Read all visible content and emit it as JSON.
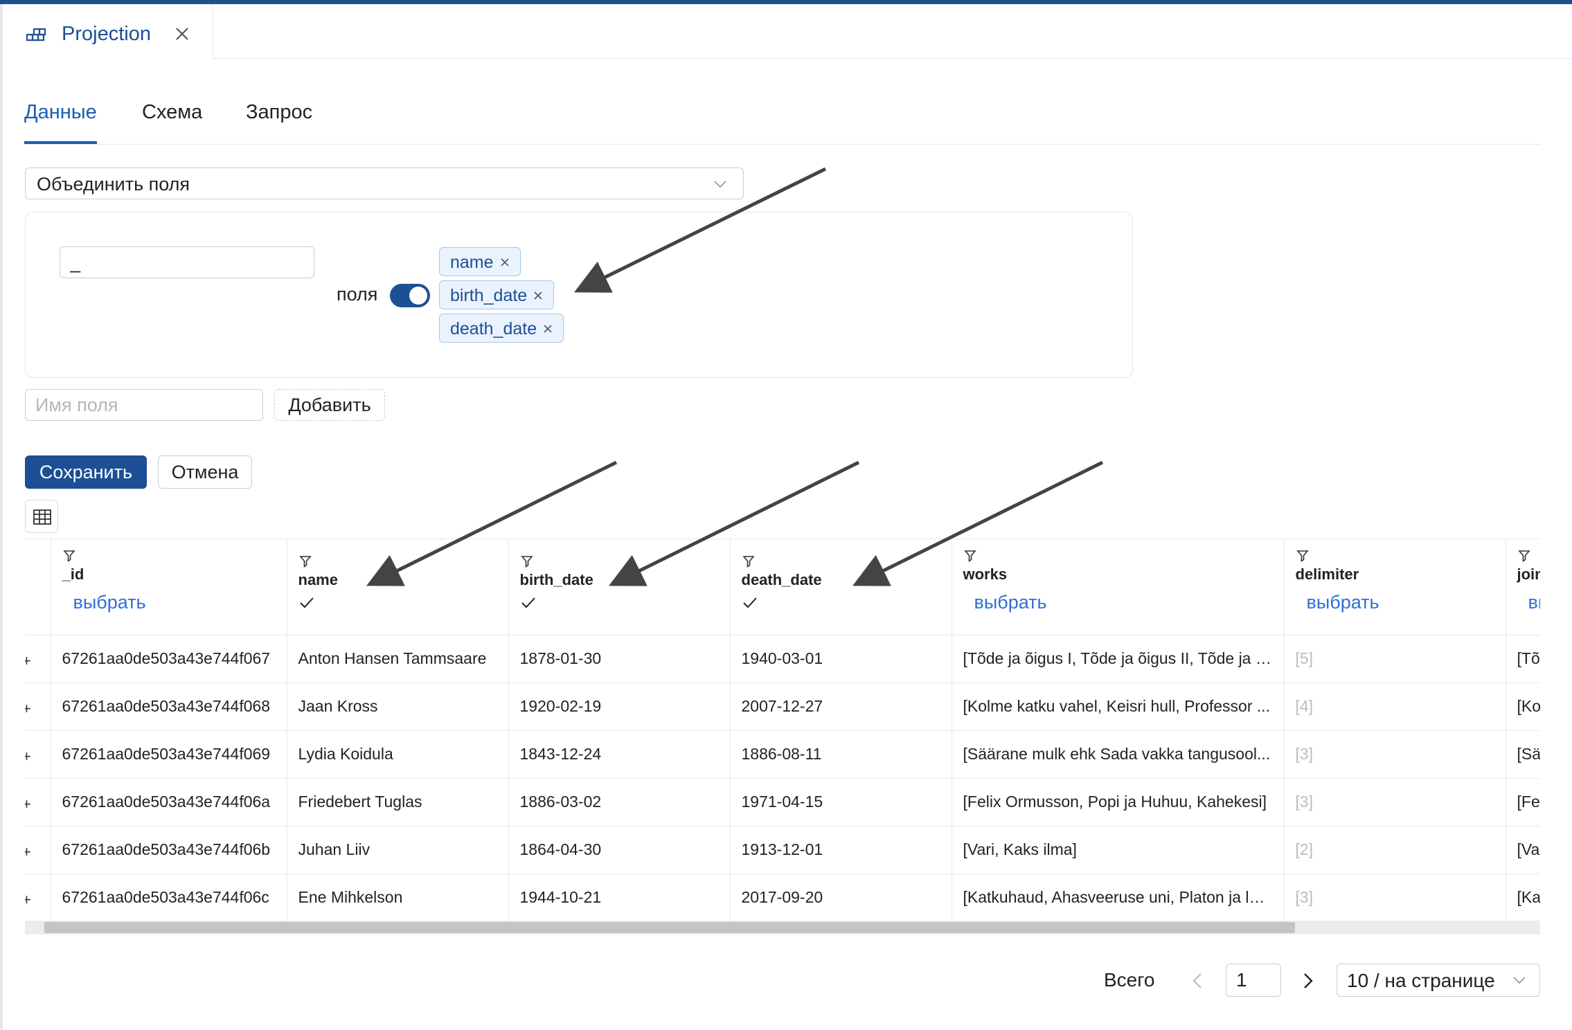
{
  "window_tab": {
    "title": "Projection",
    "icon": "projection-icon",
    "close_icon": "close-icon"
  },
  "tabs": [
    {
      "label": "Данные",
      "active": true
    },
    {
      "label": "Схема",
      "active": false
    },
    {
      "label": "Запрос",
      "active": false
    }
  ],
  "operation_select": {
    "value": "Объединить поля",
    "icon": "chevron-down-icon"
  },
  "merge_config": {
    "separator_value": "_",
    "fields_label": "поля",
    "toggle_on": true,
    "selected_fields": [
      "name",
      "birth_date",
      "death_date"
    ]
  },
  "add_field": {
    "placeholder": "Имя поля",
    "button_label": "Добавить"
  },
  "actions": {
    "save_label": "Сохранить",
    "cancel_label": "Отмена"
  },
  "table": {
    "columns": [
      {
        "key": "_id",
        "title": "_id",
        "state": "pick",
        "pick_label": "выбрать"
      },
      {
        "key": "name",
        "title": "name",
        "state": "check"
      },
      {
        "key": "birth_date",
        "title": "birth_date",
        "state": "check"
      },
      {
        "key": "death_date",
        "title": "death_date",
        "state": "check"
      },
      {
        "key": "works",
        "title": "works",
        "state": "pick",
        "pick_label": "выбрать"
      },
      {
        "key": "delimiter",
        "title": "delimiter",
        "state": "pick",
        "pick_label": "выбрать"
      },
      {
        "key": "join",
        "title": "join",
        "state": "pick",
        "pick_label": "выбрать"
      }
    ],
    "rows": [
      {
        "_id": "67261aa0de503a43e744f067",
        "name": "Anton Hansen Tammsaare",
        "birth_date": "1878-01-30",
        "death_date": "1940-03-01",
        "works": "[Tõde ja õigus I, Tõde ja õigus II, Tõde ja õ...",
        "delimiter": "[5]",
        "join": "[Tõ"
      },
      {
        "_id": "67261aa0de503a43e744f068",
        "name": "Jaan Kross",
        "birth_date": "1920-02-19",
        "death_date": "2007-12-27",
        "works": "[Kolme katku vahel, Keisri hull, Professor ...",
        "delimiter": "[4]",
        "join": "[Ko"
      },
      {
        "_id": "67261aa0de503a43e744f069",
        "name": "Lydia Koidula",
        "birth_date": "1843-12-24",
        "death_date": "1886-08-11",
        "works": "[Säärane mulk ehk Sada vakka tangusool...",
        "delimiter": "[3]",
        "join": "[Sä"
      },
      {
        "_id": "67261aa0de503a43e744f06a",
        "name": "Friedebert Tuglas",
        "birth_date": "1886-03-02",
        "death_date": "1971-04-15",
        "works": "[Felix Ormusson, Popi ja Huhuu, Kahekesi]",
        "delimiter": "[3]",
        "join": "[Fe"
      },
      {
        "_id": "67261aa0de503a43e744f06b",
        "name": "Juhan Liiv",
        "birth_date": "1864-04-30",
        "death_date": "1913-12-01",
        "works": "[Vari, Kaks ilma]",
        "delimiter": "[2]",
        "join": "[Va"
      },
      {
        "_id": "67261aa0de503a43e744f06c",
        "name": "Ene Mihkelson",
        "birth_date": "1944-10-21",
        "death_date": "2017-09-20",
        "works": "[Katkuhaud, Ahasveeruse uni, Platon ja lai...",
        "delimiter": "[3]",
        "join": "[Ka"
      }
    ]
  },
  "pagination": {
    "total_label": "Всего",
    "current_page": "1",
    "page_size_label": "10 / на странице"
  },
  "colors": {
    "accent": "#1d4f95",
    "link": "#2f6fd6",
    "tag_bg": "#eaf2fd",
    "tag_border": "#a9c6ee"
  }
}
